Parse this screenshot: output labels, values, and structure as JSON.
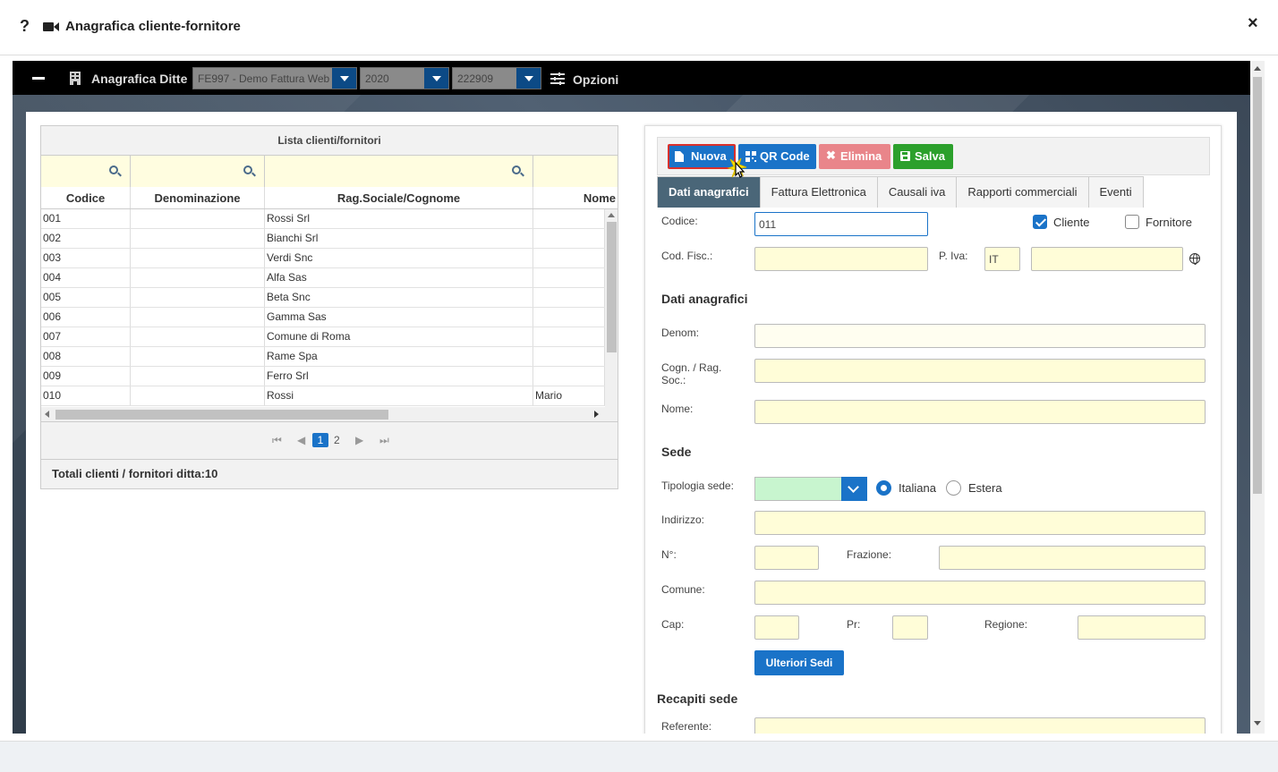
{
  "window": {
    "help": "?",
    "title": "Anagrafica cliente-fornitore",
    "close": "×"
  },
  "topbar": {
    "label": "Anagrafica Ditte",
    "company": "FE997 - Demo Fattura Web",
    "year": "2020",
    "code": "222909",
    "options": "Opzioni"
  },
  "grid": {
    "title": "Lista clienti/fornitori",
    "columns": [
      "Codice",
      "Denominazione",
      "Rag.Sociale/Cognome",
      "Nome"
    ],
    "rows": [
      {
        "codice": "001",
        "denom": "",
        "rag": "Rossi Srl",
        "nome": ""
      },
      {
        "codice": "002",
        "denom": "",
        "rag": "Bianchi Srl",
        "nome": ""
      },
      {
        "codice": "003",
        "denom": "",
        "rag": "Verdi Snc",
        "nome": ""
      },
      {
        "codice": "004",
        "denom": "",
        "rag": "Alfa Sas",
        "nome": ""
      },
      {
        "codice": "005",
        "denom": "",
        "rag": "Beta Snc",
        "nome": ""
      },
      {
        "codice": "006",
        "denom": "",
        "rag": "Gamma Sas",
        "nome": ""
      },
      {
        "codice": "007",
        "denom": "",
        "rag": "Comune di Roma",
        "nome": ""
      },
      {
        "codice": "008",
        "denom": "",
        "rag": "Rame Spa",
        "nome": ""
      },
      {
        "codice": "009",
        "denom": "",
        "rag": "Ferro Srl",
        "nome": ""
      },
      {
        "codice": "010",
        "denom": "",
        "rag": "Rossi",
        "nome": "Mario"
      }
    ],
    "pages": [
      "1",
      "2"
    ],
    "totals_label": "Totali clienti / fornitori ditta:",
    "totals_value": "10"
  },
  "toolbar": {
    "nuova": "Nuova",
    "qr": "QR Code",
    "elimina": "Elimina",
    "salva": "Salva"
  },
  "tabs": [
    "Dati anagrafici",
    "Fattura Elettronica",
    "Causali iva",
    "Rapporti commerciali",
    "Eventi"
  ],
  "form": {
    "codice_label": "Codice:",
    "codice_value": "011",
    "cliente_label": "Cliente",
    "cliente_checked": true,
    "fornitore_label": "Fornitore",
    "fornitore_checked": false,
    "codfisc_label": "Cod. Fisc.:",
    "piva_label": "P. Iva:",
    "piva_country": "IT",
    "section_anag": "Dati anagrafici",
    "denom_label": "Denom:",
    "cogn_label_1": "Cogn. / Rag.",
    "cogn_label_2": "Soc.:",
    "nome_label": "Nome:",
    "section_sede": "Sede",
    "tipologia_label": "Tipologia sede:",
    "italiana_label": "Italiana",
    "estera_label": "Estera",
    "indirizzo_label": "Indirizzo:",
    "numero_label": "N°:",
    "frazione_label": "Frazione:",
    "comune_label": "Comune:",
    "cap_label": "Cap:",
    "pr_label": "Pr:",
    "regione_label": "Regione:",
    "ulteriori_label": "Ulteriori Sedi",
    "section_recapiti": "Recapiti sede",
    "referente_label": "Referente:"
  },
  "colors": {
    "primary": "#1a73c8",
    "danger": "#e9858a",
    "success": "#2ca02c",
    "input_bg": "#fffdd8",
    "tab_active": "#4a6678"
  }
}
